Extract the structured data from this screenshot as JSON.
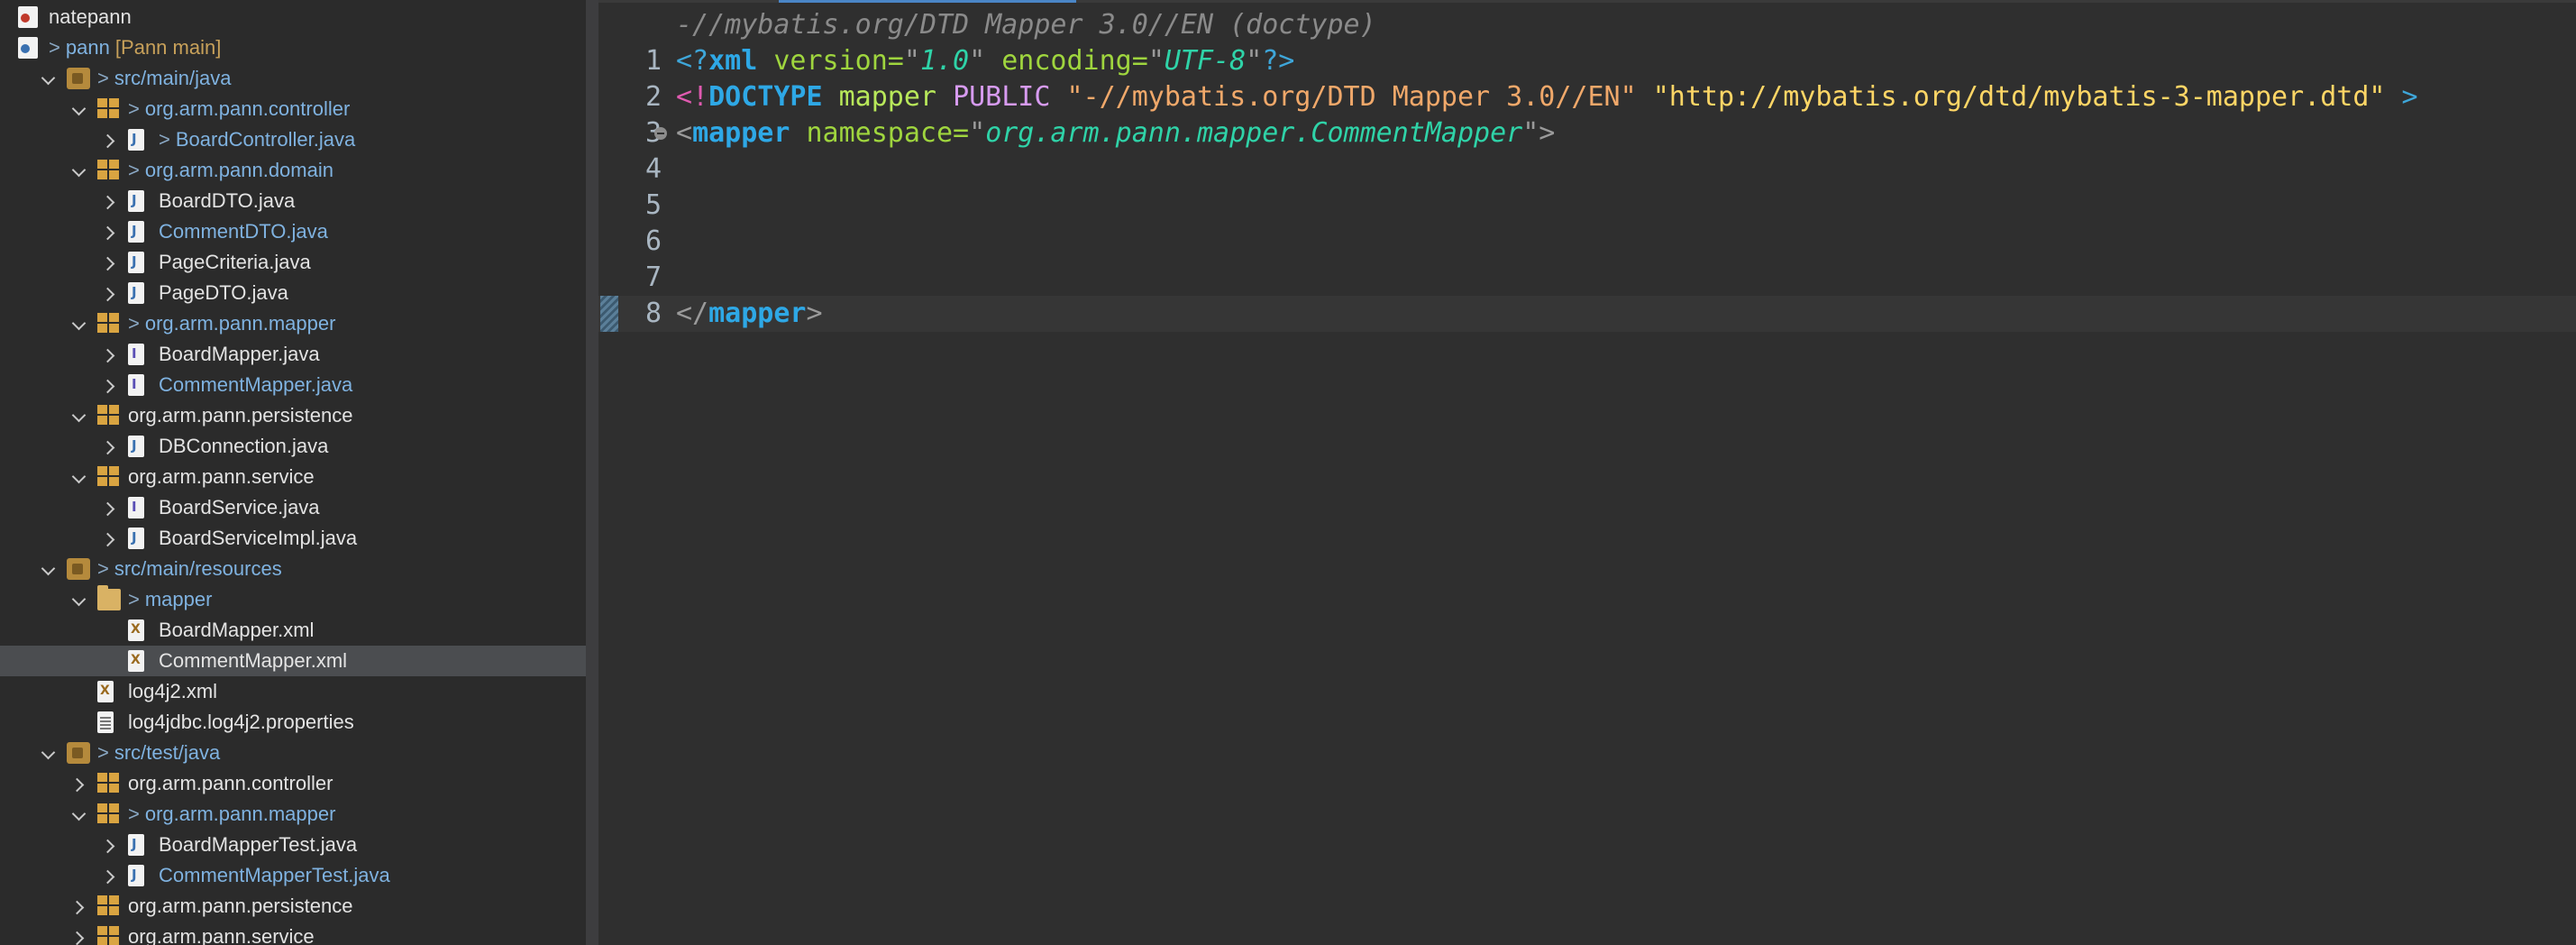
{
  "explorer": {
    "rows": [
      {
        "label": "natepann",
        "prefix": "",
        "suffix": "",
        "indent": 0,
        "chevron": "none",
        "icon": "project-icon",
        "color": "white"
      },
      {
        "label": "pann",
        "prefix": ">",
        "suffix": "[Pann main]",
        "indent": 0,
        "chevron": "none",
        "icon": "project-icon",
        "color": "blue"
      },
      {
        "label": "src/main/java",
        "prefix": ">",
        "suffix": "",
        "indent": 1,
        "chevron": "open",
        "icon": "source-folder-icon",
        "color": "blue"
      },
      {
        "label": "org.arm.pann.controller",
        "prefix": ">",
        "suffix": "",
        "indent": 2,
        "chevron": "open",
        "icon": "package-icon",
        "color": "blue"
      },
      {
        "label": "BoardController.java",
        "prefix": ">",
        "suffix": "",
        "indent": 3,
        "chevron": "closed",
        "icon": "java-file-icon",
        "color": "blue"
      },
      {
        "label": "org.arm.pann.domain",
        "prefix": ">",
        "suffix": "",
        "indent": 2,
        "chevron": "open",
        "icon": "package-icon",
        "color": "blue"
      },
      {
        "label": "BoardDTO.java",
        "prefix": "",
        "suffix": "",
        "indent": 3,
        "chevron": "closed",
        "icon": "java-file-icon",
        "color": "white"
      },
      {
        "label": "CommentDTO.java",
        "prefix": "",
        "suffix": "",
        "indent": 3,
        "chevron": "closed",
        "icon": "java-file-icon",
        "color": "blue"
      },
      {
        "label": "PageCriteria.java",
        "prefix": "",
        "suffix": "",
        "indent": 3,
        "chevron": "closed",
        "icon": "java-file-icon",
        "color": "white"
      },
      {
        "label": "PageDTO.java",
        "prefix": "",
        "suffix": "",
        "indent": 3,
        "chevron": "closed",
        "icon": "java-file-icon",
        "color": "white"
      },
      {
        "label": "org.arm.pann.mapper",
        "prefix": ">",
        "suffix": "",
        "indent": 2,
        "chevron": "open",
        "icon": "package-icon",
        "color": "blue"
      },
      {
        "label": "BoardMapper.java",
        "prefix": "",
        "suffix": "",
        "indent": 3,
        "chevron": "closed",
        "icon": "java-interface-icon",
        "color": "white"
      },
      {
        "label": "CommentMapper.java",
        "prefix": "",
        "suffix": "",
        "indent": 3,
        "chevron": "closed",
        "icon": "java-interface-icon",
        "color": "blue"
      },
      {
        "label": "org.arm.pann.persistence",
        "prefix": "",
        "suffix": "",
        "indent": 2,
        "chevron": "open",
        "icon": "package-icon",
        "color": "white"
      },
      {
        "label": "DBConnection.java",
        "prefix": "",
        "suffix": "",
        "indent": 3,
        "chevron": "closed",
        "icon": "java-file-icon",
        "color": "white"
      },
      {
        "label": "org.arm.pann.service",
        "prefix": "",
        "suffix": "",
        "indent": 2,
        "chevron": "open",
        "icon": "package-icon",
        "color": "white"
      },
      {
        "label": "BoardService.java",
        "prefix": "",
        "suffix": "",
        "indent": 3,
        "chevron": "closed",
        "icon": "java-interface-icon",
        "color": "white"
      },
      {
        "label": "BoardServiceImpl.java",
        "prefix": "",
        "suffix": "",
        "indent": 3,
        "chevron": "closed",
        "icon": "java-file-icon",
        "color": "white"
      },
      {
        "label": "src/main/resources",
        "prefix": ">",
        "suffix": "",
        "indent": 1,
        "chevron": "open",
        "icon": "source-folder-icon",
        "color": "blue"
      },
      {
        "label": "mapper",
        "prefix": ">",
        "suffix": "",
        "indent": 2,
        "chevron": "open",
        "icon": "folder-icon",
        "color": "blue"
      },
      {
        "label": "BoardMapper.xml",
        "prefix": "",
        "suffix": "",
        "indent": 3,
        "chevron": "none",
        "icon": "xml-file-icon",
        "color": "white"
      },
      {
        "label": "CommentMapper.xml",
        "prefix": "",
        "suffix": "",
        "indent": 3,
        "chevron": "none",
        "icon": "xml-file-icon",
        "color": "white",
        "selected": true
      },
      {
        "label": "log4j2.xml",
        "prefix": "",
        "suffix": "",
        "indent": 2,
        "chevron": "none",
        "icon": "xml-file-icon",
        "color": "white"
      },
      {
        "label": "log4jdbc.log4j2.properties",
        "prefix": "",
        "suffix": "",
        "indent": 2,
        "chevron": "none",
        "icon": "properties-file-icon",
        "color": "white"
      },
      {
        "label": "src/test/java",
        "prefix": ">",
        "suffix": "",
        "indent": 1,
        "chevron": "open",
        "icon": "source-folder-icon",
        "color": "blue"
      },
      {
        "label": "org.arm.pann.controller",
        "prefix": "",
        "suffix": "",
        "indent": 2,
        "chevron": "closed",
        "icon": "package-icon",
        "color": "white"
      },
      {
        "label": "org.arm.pann.mapper",
        "prefix": ">",
        "suffix": "",
        "indent": 2,
        "chevron": "open",
        "icon": "package-icon",
        "color": "blue"
      },
      {
        "label": "BoardMapperTest.java",
        "prefix": "",
        "suffix": "",
        "indent": 3,
        "chevron": "closed",
        "icon": "java-file-icon",
        "color": "white"
      },
      {
        "label": "CommentMapperTest.java",
        "prefix": "",
        "suffix": "",
        "indent": 3,
        "chevron": "closed",
        "icon": "java-file-icon",
        "color": "blue"
      },
      {
        "label": "org.arm.pann.persistence",
        "prefix": "",
        "suffix": "",
        "indent": 2,
        "chevron": "closed",
        "icon": "package-icon",
        "color": "white"
      },
      {
        "label": "org.arm.pann.service",
        "prefix": "",
        "suffix": "",
        "indent": 2,
        "chevron": "closed",
        "icon": "package-icon",
        "color": "white"
      }
    ]
  },
  "editor": {
    "breadcrumb": "-//mybatis.org/DTD Mapper 3.0//EN (doctype)",
    "lines": [
      {
        "num": "1",
        "tokens": [
          {
            "t": "<?",
            "c": "pi"
          },
          {
            "t": "xml",
            "c": "tag"
          },
          {
            "t": " version=",
            "c": "attr"
          },
          {
            "t": "\"",
            "c": "punct"
          },
          {
            "t": "1.0",
            "c": "val"
          },
          {
            "t": "\"",
            "c": "punct"
          },
          {
            "t": " encoding=",
            "c": "attr"
          },
          {
            "t": "\"",
            "c": "punct"
          },
          {
            "t": "UTF-8",
            "c": "val"
          },
          {
            "t": "\"",
            "c": "punct"
          },
          {
            "t": "?>",
            "c": "pi"
          }
        ]
      },
      {
        "num": "2",
        "tokens": [
          {
            "t": "<!",
            "c": "bang"
          },
          {
            "t": "DOCTYPE",
            "c": "kw"
          },
          {
            "t": " mapper ",
            "c": "doc"
          },
          {
            "t": "PUBLIC",
            "c": "public"
          },
          {
            "t": " \"-//mybatis.org/DTD Mapper 3.0//EN\"",
            "c": "str"
          },
          {
            "t": " \"http://mybatis.org/dtd/mybatis-3-mapper.dtd\"",
            "c": "str2"
          },
          {
            "t": " >",
            "c": "pi"
          }
        ]
      },
      {
        "num": "3",
        "fold": true,
        "tokens": [
          {
            "t": "<",
            "c": "punct"
          },
          {
            "t": "mapper",
            "c": "tag"
          },
          {
            "t": " namespace=",
            "c": "attr"
          },
          {
            "t": "\"",
            "c": "punct"
          },
          {
            "t": "org.arm.pann.mapper.CommentMapper",
            "c": "val"
          },
          {
            "t": "\">",
            "c": "punct"
          }
        ]
      },
      {
        "num": "4",
        "tokens": []
      },
      {
        "num": "5",
        "tokens": []
      },
      {
        "num": "6",
        "tokens": []
      },
      {
        "num": "7",
        "tokens": []
      },
      {
        "num": "8",
        "current": true,
        "tokens": [
          {
            "t": "</",
            "c": "punct"
          },
          {
            "t": "mapper",
            "c": "tag"
          },
          {
            "t": ">",
            "c": "punct"
          }
        ]
      }
    ]
  }
}
